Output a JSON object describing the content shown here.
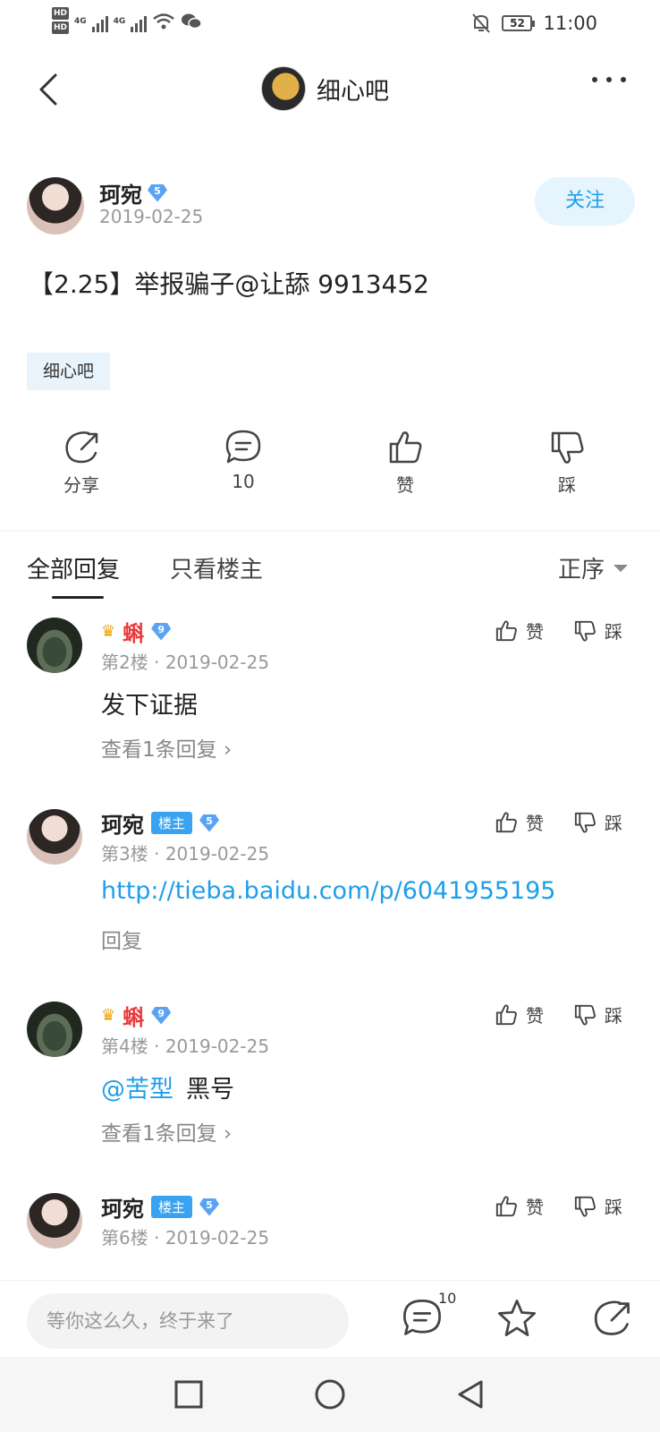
{
  "status_bar": {
    "hd1": "HD",
    "hd2": "HD",
    "net1": "4G",
    "net2": "4G",
    "battery": "52",
    "time": "11:00"
  },
  "nav": {
    "forum_title": "细心吧"
  },
  "post": {
    "author": "珂宛",
    "author_level": "5",
    "date": "2019-02-25",
    "follow_label": "关注",
    "title": "【2.25】举报骗子@让舔  9913452",
    "forum_tag": "细心吧"
  },
  "actions": {
    "share": "分享",
    "comments": "10",
    "like": "赞",
    "dislike": "踩"
  },
  "tabs": {
    "all": "全部回复",
    "owner_only": "只看楼主",
    "sort": "正序"
  },
  "replies": [
    {
      "name": "蝌",
      "level": "9",
      "owner_badge": "",
      "floor": "第2楼",
      "date": "2019-02-25",
      "mention": "",
      "content": "发下证据",
      "sub": "查看1条回复",
      "like": "赞",
      "dislike": "踩"
    },
    {
      "name": "珂宛",
      "level": "5",
      "owner_badge": "楼主",
      "floor": "第3楼",
      "date": "2019-02-25",
      "content": "http://tieba.baidu.com/p/6041955195",
      "sub": "回复",
      "like": "赞",
      "dislike": "踩"
    },
    {
      "name": "蝌",
      "level": "9",
      "owner_badge": "",
      "floor": "第4楼",
      "date": "2019-02-25",
      "mention": "@苦型",
      "content": "黑号",
      "sub": "查看1条回复",
      "like": "赞",
      "dislike": "踩"
    },
    {
      "name": "珂宛",
      "level": "5",
      "owner_badge": "楼主",
      "floor": "第6楼",
      "date": "2019-02-25",
      "like": "赞",
      "dislike": "踩"
    }
  ],
  "bottom_bar": {
    "input_placeholder": "等你这么久，终于来了",
    "comment_count": "10"
  },
  "colors": {
    "accent_blue": "#1e9fe9",
    "owner_badge_bg": "#3aa3f1",
    "red_name": "#ea3b3b",
    "diamond": "#5aa3f3"
  }
}
